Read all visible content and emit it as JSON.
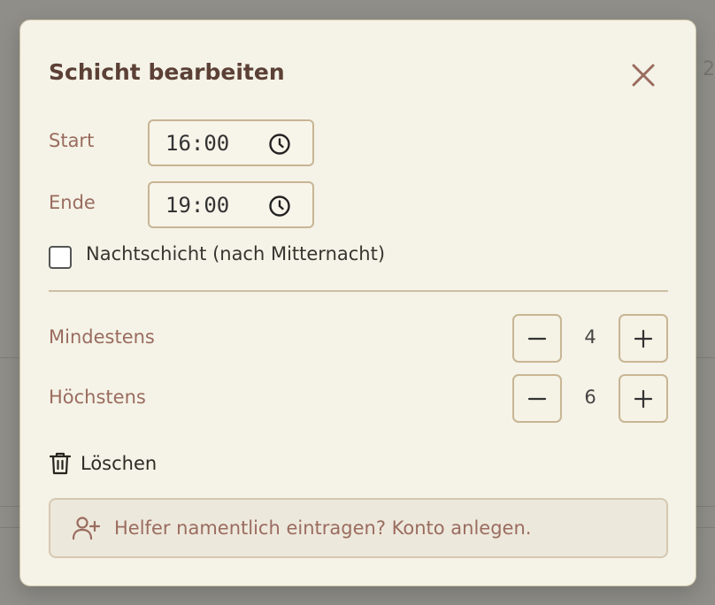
{
  "dialog": {
    "title": "Schicht bearbeiten",
    "start_label": "Start",
    "start_value": "16:00",
    "end_label": "Ende",
    "end_value": "19:00",
    "night_shift_label": "Nachtschicht (nach Mitternacht)",
    "night_shift_checked": false,
    "min_label": "Mindestens",
    "min_value": "4",
    "max_label": "Höchstens",
    "max_value": "6",
    "delete_label": "Löschen",
    "helper_text": "Helfer namentlich eintragen? Konto anlegen."
  },
  "background": {
    "partial_char": "2"
  },
  "icons": {
    "close": "close-icon",
    "time": "clock-icon",
    "decrement": "minus-icon",
    "increment": "plus-icon",
    "delete": "trash-icon",
    "add_user": "user-plus-icon"
  },
  "colors": {
    "title": "#5c4036",
    "label": "#9a6c5f",
    "modal_bg": "#f5f3e7",
    "border": "#c8b594",
    "overlay": "#8f8e89"
  }
}
